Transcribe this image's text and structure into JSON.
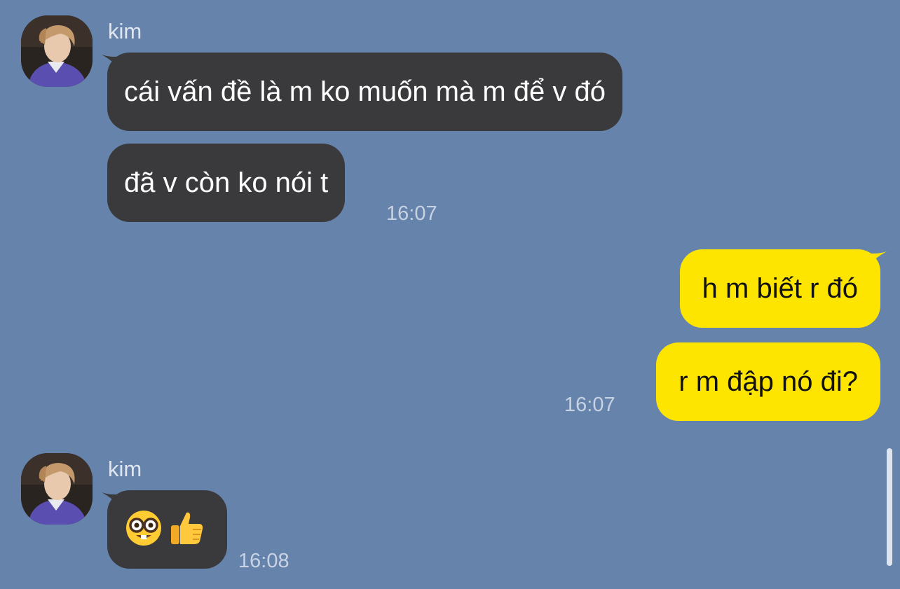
{
  "messages": [
    {
      "sender": "kim",
      "lines": [
        "cái vấn đề là m ko muốn mà m để v đó",
        "đã v còn ko nói t"
      ],
      "time": "16:07"
    },
    {
      "sender": "me",
      "lines": [
        "h m biết r đó",
        "r m đập nó đi?"
      ],
      "time": "16:07"
    },
    {
      "sender": "kim",
      "emojis": [
        "nerd-face-icon",
        "thumbs-up-icon"
      ],
      "time": "16:08"
    }
  ],
  "colors": {
    "background": "#6683ab",
    "incoming_bubble": "#3a3a3c",
    "outgoing_bubble": "#fee500"
  }
}
